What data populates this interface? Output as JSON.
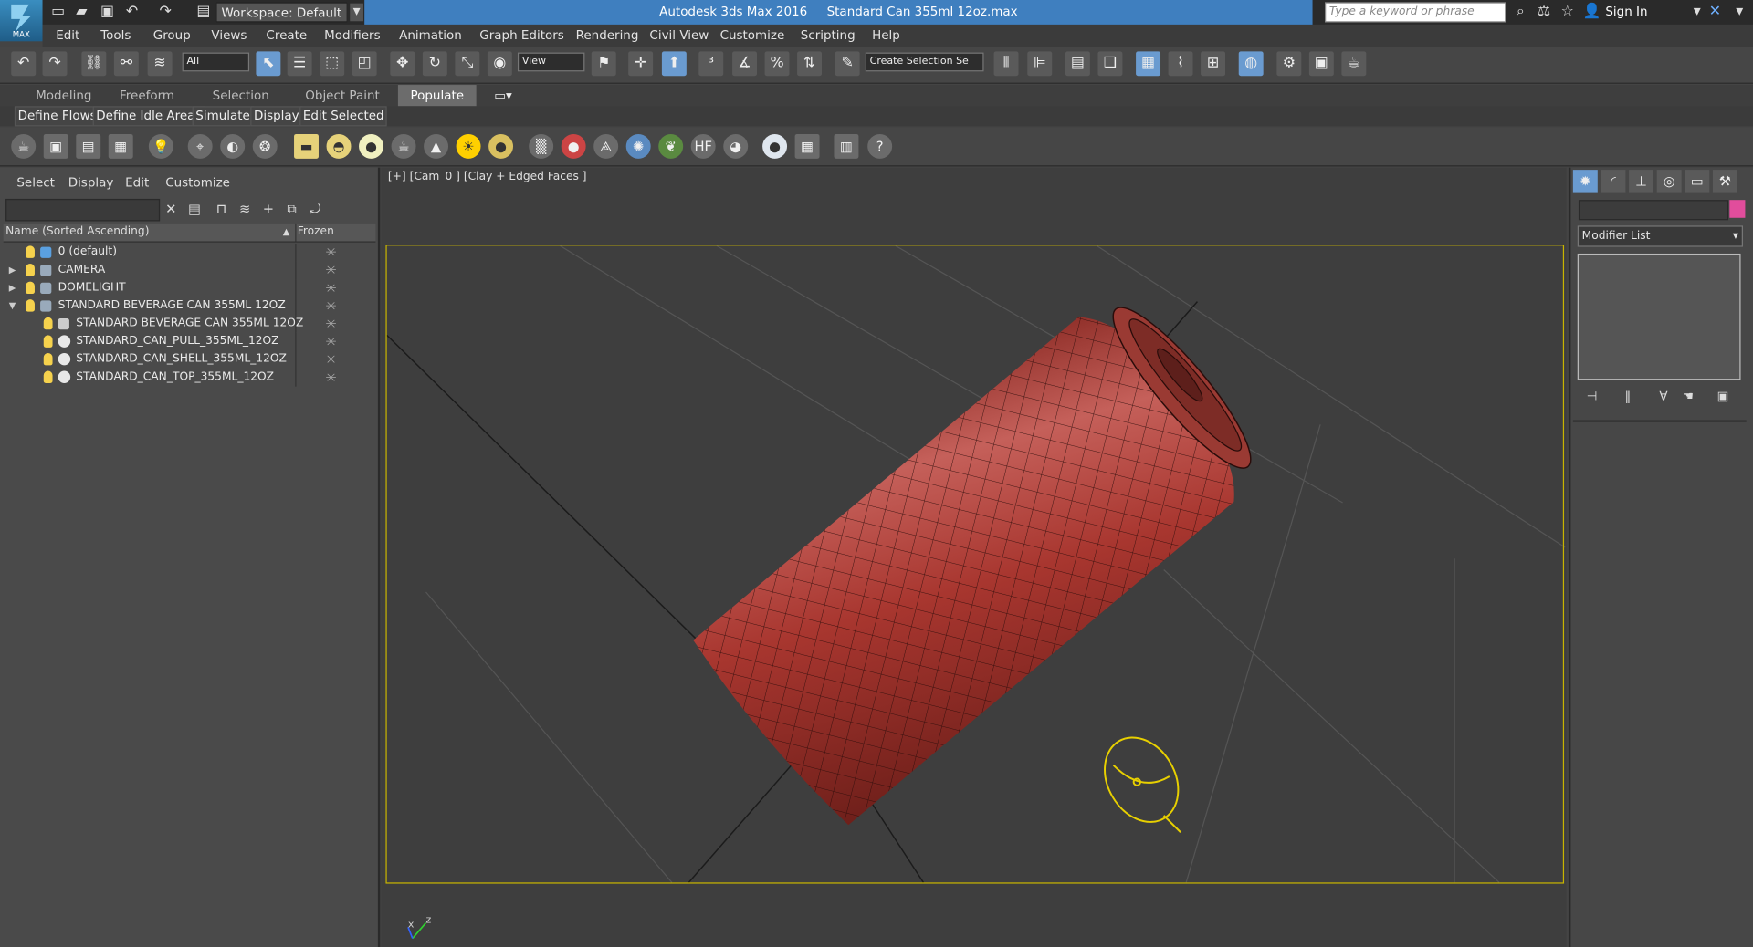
{
  "title": {
    "app": "Autodesk 3ds Max 2016",
    "file": "Standard Can 355ml 12oz.max",
    "logo_text": "MAX",
    "workspace": "Workspace: Default",
    "search_placeholder": "Type a keyword or phrase",
    "sign_in": "Sign In"
  },
  "menu": [
    "Edit",
    "Tools",
    "Group",
    "Views",
    "Create",
    "Modifiers",
    "Animation",
    "Graph Editors",
    "Rendering",
    "Civil View",
    "Customize",
    "Scripting",
    "Help"
  ],
  "toolbar": {
    "selection_filter": "All",
    "ref_coord": "View",
    "named_selection": "Create Selection Se"
  },
  "ribbon": {
    "tabs": [
      "Modeling",
      "Freeform",
      "Selection",
      "Object Paint",
      "Populate"
    ],
    "active_tab": "Populate",
    "sub_buttons": [
      "Define Flows",
      "Define Idle Areas",
      "Simulate",
      "Display",
      "Edit Selected"
    ]
  },
  "scene_explorer": {
    "menu": [
      "Select",
      "Display",
      "Edit",
      "Customize"
    ],
    "columns": {
      "name": "Name (Sorted Ascending)",
      "frozen": "Frozen",
      "sort_arrow": "▲"
    },
    "rows": [
      {
        "label": "0 (default)",
        "type": "layer",
        "level": 0,
        "expander": ""
      },
      {
        "label": "CAMERA",
        "type": "layer",
        "level": 0,
        "expander": "▶"
      },
      {
        "label": "DOMELIGHT",
        "type": "layer",
        "level": 0,
        "expander": "▶"
      },
      {
        "label": "STANDARD BEVERAGE CAN 355ML 12OZ",
        "type": "layer",
        "level": 0,
        "expander": "▼"
      },
      {
        "label": "STANDARD BEVERAGE CAN 355ML 12OZ",
        "type": "group",
        "level": 1,
        "expander": ""
      },
      {
        "label": "STANDARD_CAN_PULL_355ML_12OZ",
        "type": "object",
        "level": 1,
        "expander": ""
      },
      {
        "label": "STANDARD_CAN_SHELL_355ML_12OZ",
        "type": "object",
        "level": 1,
        "expander": ""
      },
      {
        "label": "STANDARD_CAN_TOP_355ML_12OZ",
        "type": "object",
        "level": 1,
        "expander": ""
      }
    ],
    "frozen_glyph": "✳"
  },
  "viewport": {
    "label": "[+] [Cam_0 ] [Clay + Edged Faces ]",
    "can_color": "#a8362f",
    "frame_color": "#c8b400",
    "axis_x": "x",
    "axis_z": "z"
  },
  "command_panel": {
    "modifier_list": "Modifier List",
    "object_color": "#e14d9c"
  },
  "icons": {
    "undo": "↶",
    "redo": "↷",
    "move": "✥",
    "rotate": "↻",
    "close": "✕",
    "lock": "🔒",
    "plus": "+",
    "dropdown": "▾",
    "help": "?"
  }
}
